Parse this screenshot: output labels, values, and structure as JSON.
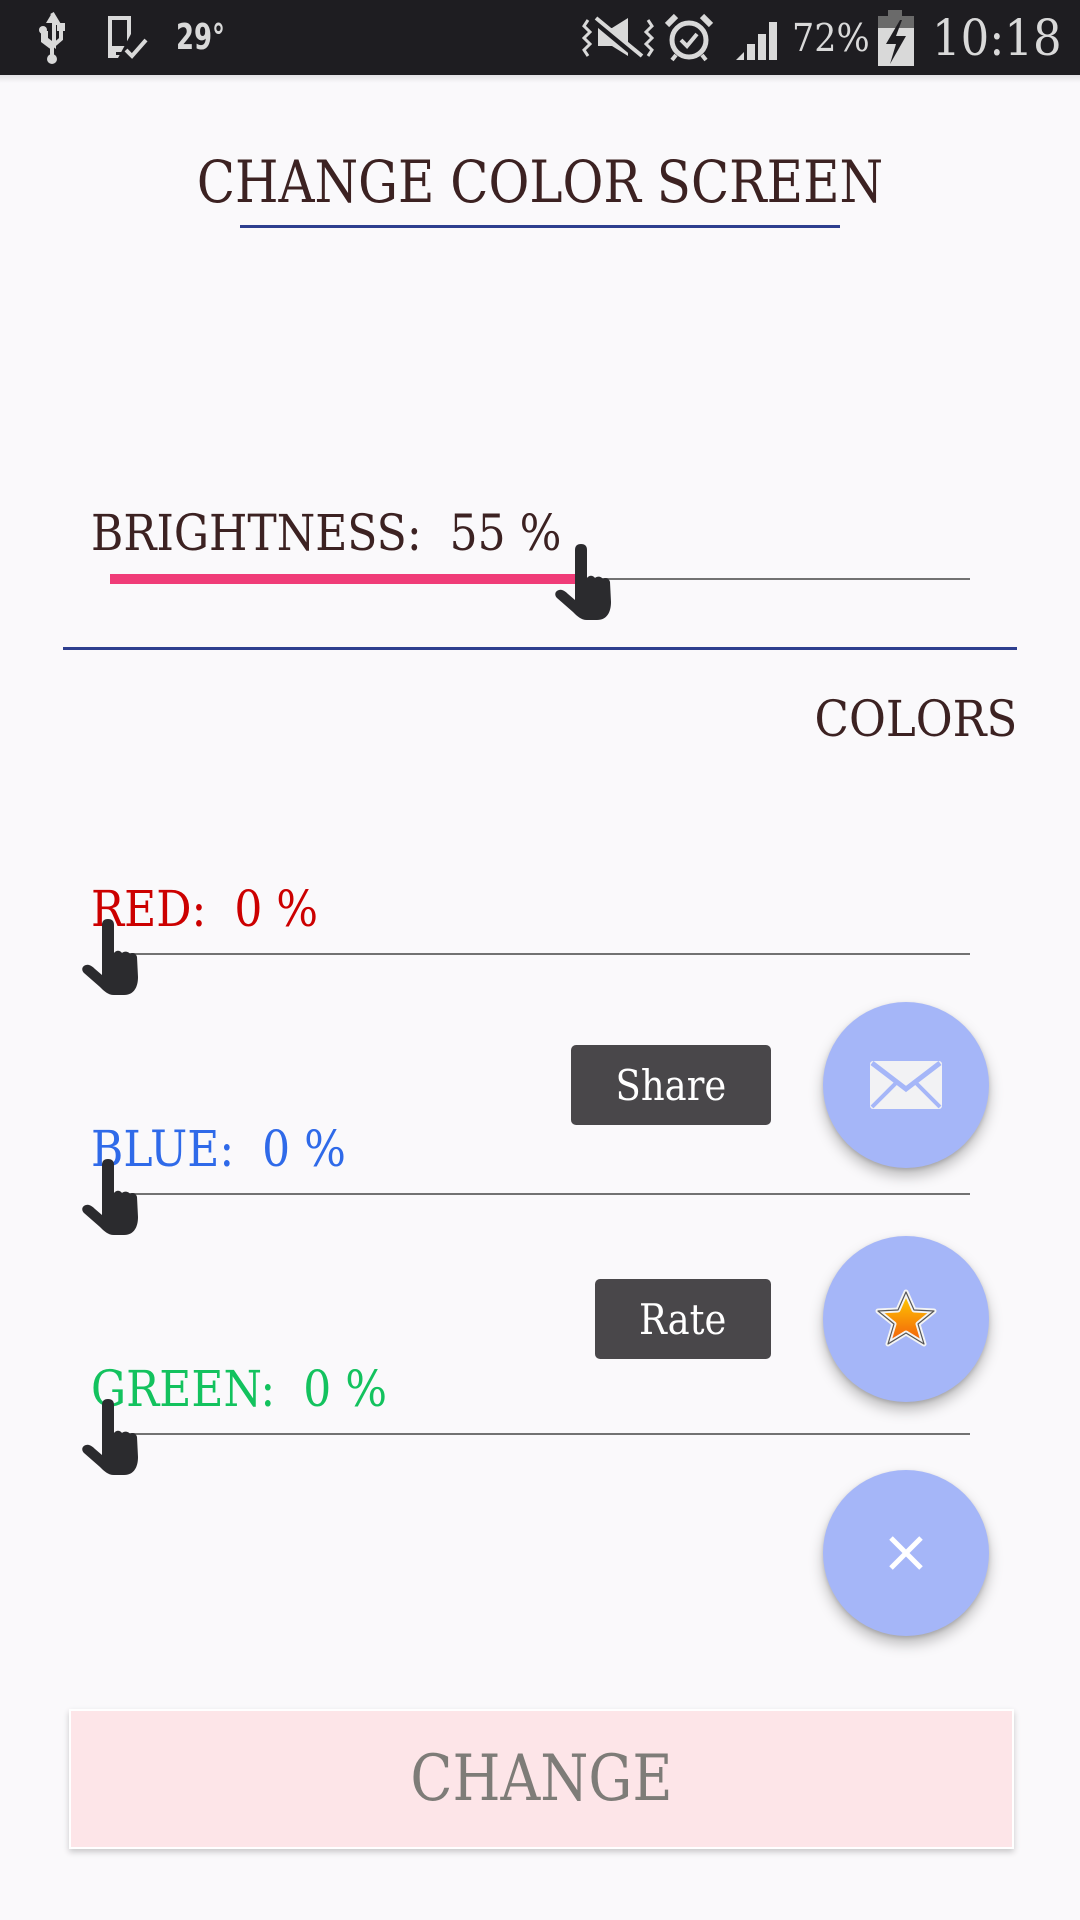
{
  "status_bar": {
    "temperature": "29°",
    "battery_percent": "72%",
    "time": "10:18",
    "left_icons": [
      "usb-icon",
      "device-check-icon"
    ],
    "right_icons": [
      "vibrate-mute-icon",
      "alarm-icon",
      "signal-icon",
      "battery-charging-icon"
    ]
  },
  "header": {
    "title": "CHANGE COLOR SCREEN"
  },
  "brightness": {
    "label": "BRIGHTNESS:",
    "value_text": "55 %",
    "value_percent": 55,
    "accent_color": "#f03c78"
  },
  "colors_section": {
    "heading": "COLORS",
    "sliders": [
      {
        "name": "red",
        "label": "RED:",
        "value_text": "0 %",
        "value_percent": 0,
        "color": "#cc0000"
      },
      {
        "name": "blue",
        "label": "BLUE:",
        "value_text": "0 %",
        "value_percent": 0,
        "color": "#2f6ae9"
      },
      {
        "name": "green",
        "label": "GREEN:",
        "value_text": "0 %",
        "value_percent": 0,
        "color": "#13c25e"
      }
    ]
  },
  "fab_menu": {
    "share_label": "Share",
    "rate_label": "Rate",
    "share_icon": "envelope-icon",
    "rate_icon": "star-icon",
    "close_icon": "close-icon",
    "fab_color": "#a5b6f8"
  },
  "change_button": {
    "label": "CHANGE"
  }
}
